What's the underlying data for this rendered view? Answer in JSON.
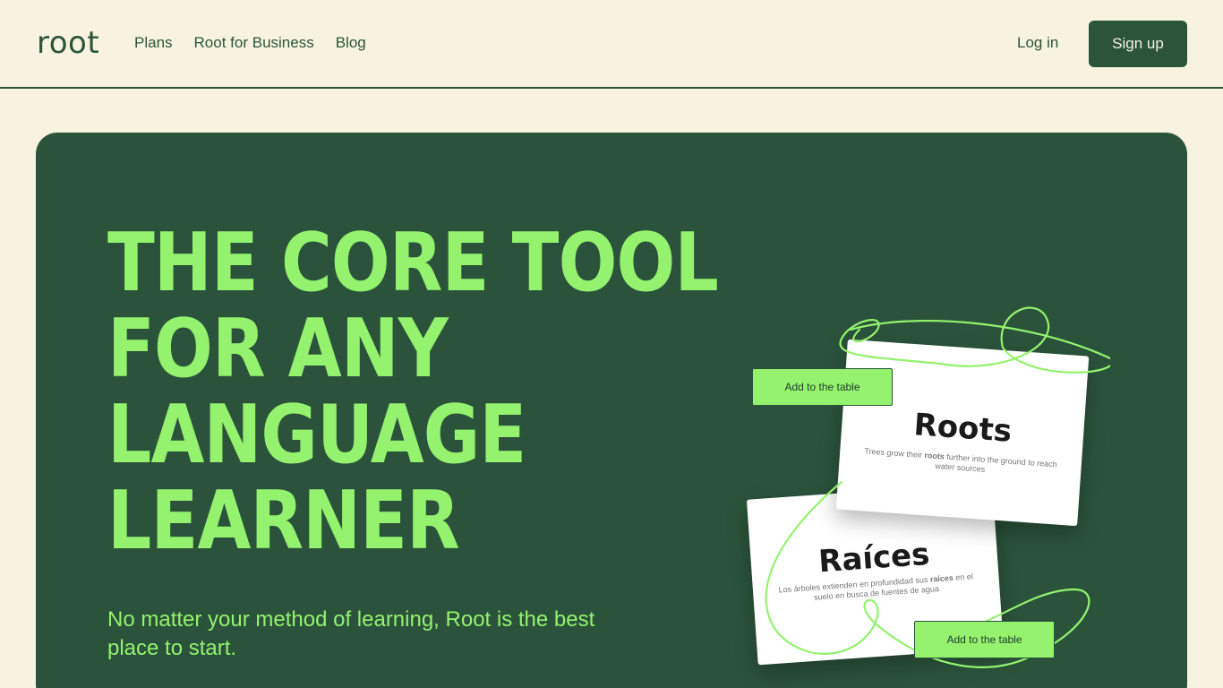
{
  "header": {
    "logo": "root",
    "nav": [
      "Plans",
      "Root for Business",
      "Blog"
    ],
    "login": "Log in",
    "signup": "Sign up"
  },
  "hero": {
    "headline": [
      "THE CORE TOOL",
      "FOR ANY",
      "LANGUAGE",
      "LEARNER"
    ],
    "subtitle": "No matter your method of learning, Root is the best place to start."
  },
  "cards": {
    "roots": {
      "title": "Roots",
      "desc_before": "Trees grow their ",
      "desc_bold": "roots",
      "desc_after": " further into the ground to reach water sources"
    },
    "raices": {
      "title": "Raíces",
      "desc_before": "Los árboles extienden en profundidad sus ",
      "desc_bold": "raíces",
      "desc_after": " en el suelo en busca de fuentes de agua"
    },
    "add_button": "Add to the table"
  },
  "colors": {
    "background": "#f8f3e1",
    "primary": "#2b5439",
    "accent": "#94f26f"
  }
}
